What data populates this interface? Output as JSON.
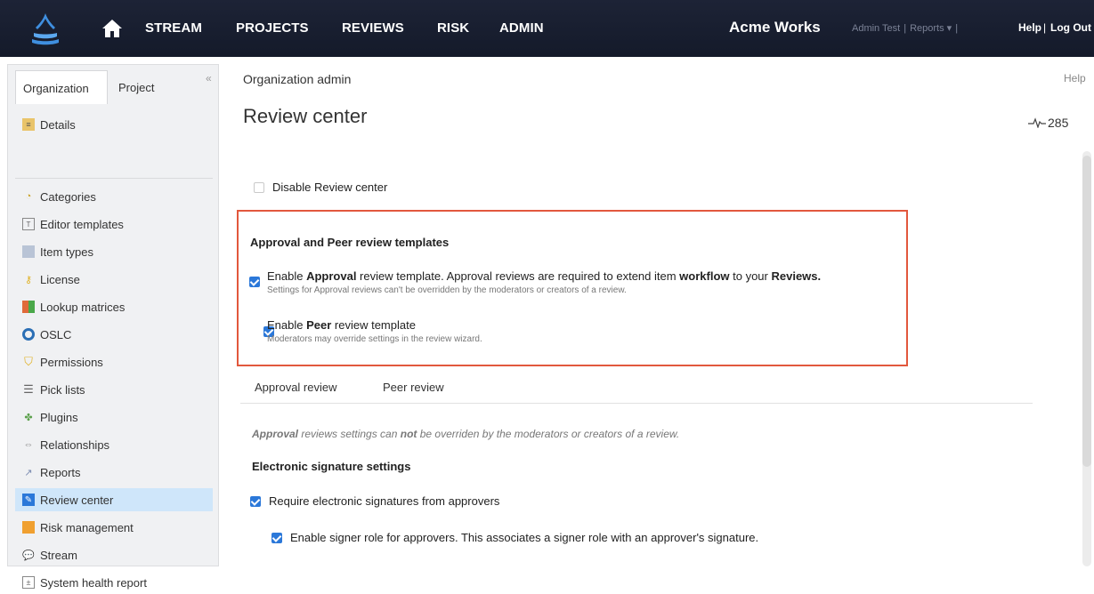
{
  "nav": {
    "items": [
      "STREAM",
      "PROJECTS",
      "REVIEWS",
      "RISK",
      "ADMIN"
    ],
    "brand": "Acme Works",
    "user": "Admin Test",
    "reports": "Reports",
    "help": "Help",
    "logout": "Log Out",
    "sep": "|",
    "icons": {
      "logo": "logo-icon",
      "home": "home-icon"
    }
  },
  "sidebar": {
    "tabs": [
      "Organization",
      "Project"
    ],
    "collapse": "«",
    "items": [
      {
        "label": "Details",
        "icon": "details-icon"
      },
      {
        "label": "Categories",
        "icon": "tag-icon"
      },
      {
        "label": "Editor templates",
        "icon": "template-icon"
      },
      {
        "label": "Item types",
        "icon": "item-types-icon"
      },
      {
        "label": "License",
        "icon": "key-icon"
      },
      {
        "label": "Lookup matrices",
        "icon": "matrix-icon"
      },
      {
        "label": "OSLC",
        "icon": "oslc-icon"
      },
      {
        "label": "Permissions",
        "icon": "shield-icon"
      },
      {
        "label": "Pick lists",
        "icon": "list-icon"
      },
      {
        "label": "Plugins",
        "icon": "plugin-icon"
      },
      {
        "label": "Relationships",
        "icon": "link-icon"
      },
      {
        "label": "Reports",
        "icon": "chart-icon"
      },
      {
        "label": "Review center",
        "icon": "review-icon",
        "active": true
      },
      {
        "label": "Risk management",
        "icon": "risk-icon"
      },
      {
        "label": "Stream",
        "icon": "chat-icon"
      },
      {
        "label": "System health report",
        "icon": "health-icon"
      }
    ]
  },
  "main": {
    "breadcrumb": "Organization admin",
    "help": "Help",
    "title": "Review center",
    "pulse_count": "285",
    "disable_label": "Disable Review center",
    "templates": {
      "heading": "Approval and Peer review templates",
      "approval": {
        "pre": "Enable ",
        "bold1": "Approval",
        "mid": " review template. Approval reviews are required to extend item ",
        "bold2": "workflow",
        "mid2": " to your ",
        "bold3": "Reviews.",
        "sub": "Settings for Approval reviews can't be overridden by the moderators or creators of a review."
      },
      "peer": {
        "pre": "Enable ",
        "bold1": "Peer",
        "post": " review template",
        "sub": "Moderators may override settings in the review wizard."
      }
    },
    "tabs": [
      "Approval review",
      "Peer review"
    ],
    "note": {
      "bold1": "Approval",
      "t1": " reviews settings can ",
      "bold2": "not",
      "t2": " be overriden by the moderators or creators of a review."
    },
    "esig_heading": "Electronic signature settings",
    "require_esig": "Require electronic signatures from approvers",
    "signer_role": "Enable signer role for approvers. This associates a signer role with an approver's signature."
  },
  "colors": {
    "nav_bg": "#141a2a",
    "accent": "#2b78d9",
    "highlight_border": "#e2583d",
    "active_item": "#cfe6fa"
  }
}
